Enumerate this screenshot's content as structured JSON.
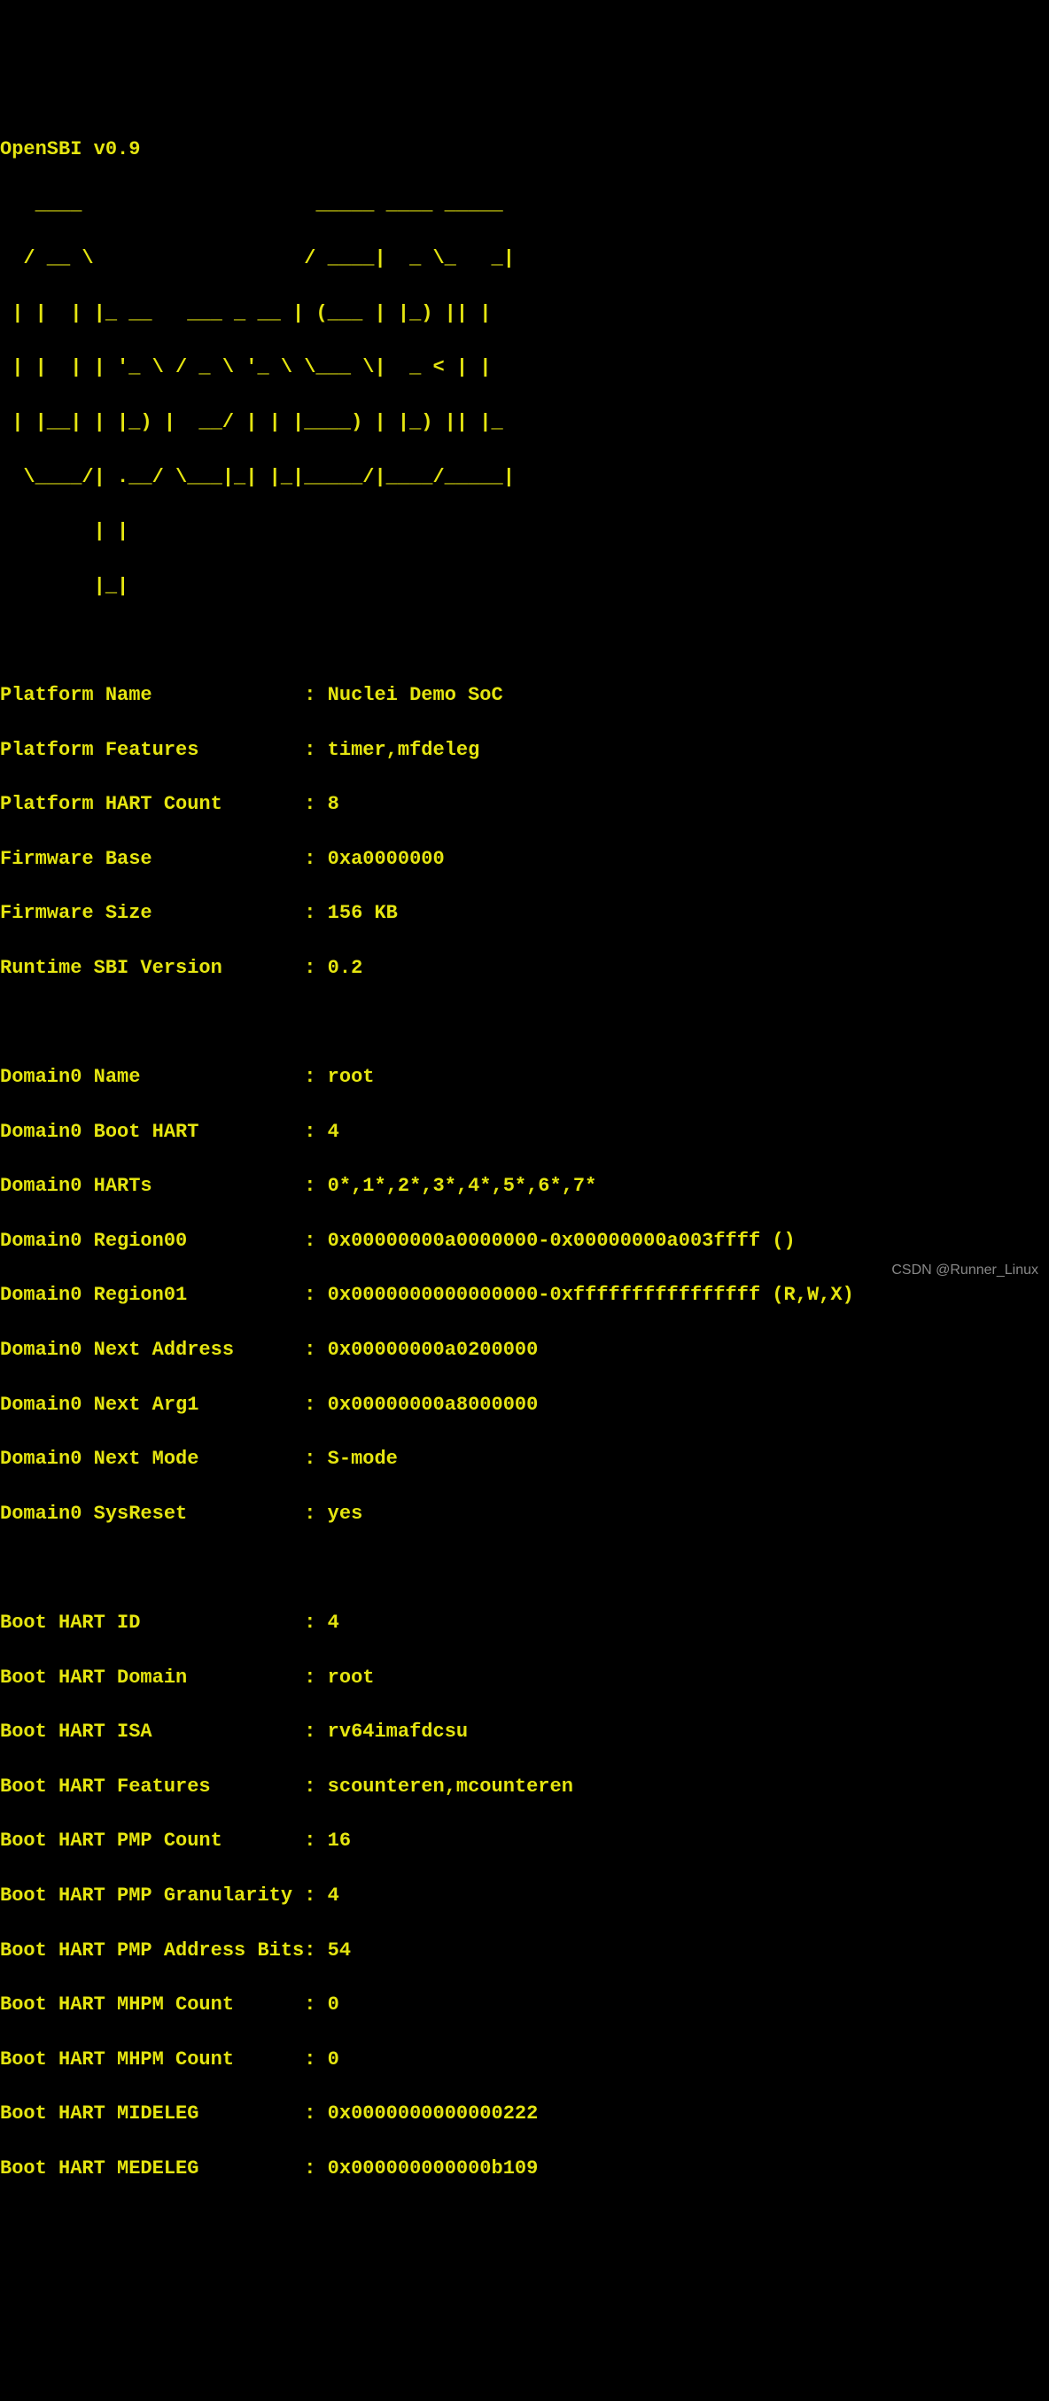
{
  "header": {
    "version": "OpenSBI v0.9"
  },
  "ascii_art": [
    "   ____                    _____ ____ _____",
    "  / __ \\                  / ____|  _ \\_   _|",
    " | |  | |_ __   ___ _ __ | (___ | |_) || |",
    " | |  | | '_ \\ / _ \\ '_ \\ \\___ \\|  _ < | |",
    " | |__| | |_) |  __/ | | |____) | |_) || |_",
    "  \\____/| .__/ \\___|_| |_|_____/|____/_____|",
    "        | |",
    "        |_|"
  ],
  "platform": {
    "name_label": "Platform Name             ",
    "name_value": "Nuclei Demo SoC",
    "features_label": "Platform Features         ",
    "features_value": "timer,mfdeleg",
    "hart_count_label": "Platform HART Count       ",
    "hart_count_value": "8",
    "fw_base_label": "Firmware Base             ",
    "fw_base_value": "0xa0000000",
    "fw_size_label": "Firmware Size             ",
    "fw_size_value": "156 KB",
    "runtime_label": "Runtime SBI Version       ",
    "runtime_value": "0.2"
  },
  "domain": {
    "name_label": "Domain0 Name              ",
    "name_value": "root",
    "boot_hart_label": "Domain0 Boot HART         ",
    "boot_hart_value": "4",
    "harts_label": "Domain0 HARTs             ",
    "harts_value": "0*,1*,2*,3*,4*,5*,6*,7*",
    "region00_label": "Domain0 Region00          ",
    "region00_value": "0x00000000a0000000-0x00000000a003ffff ()",
    "region01_label": "Domain0 Region01          ",
    "region01_value": "0x0000000000000000-0xffffffffffffffff (R,W,X)",
    "next_addr_label": "Domain0 Next Address      ",
    "next_addr_value": "0x00000000a0200000",
    "next_arg1_label": "Domain0 Next Arg1         ",
    "next_arg1_value": "0x00000000a8000000",
    "next_mode_label": "Domain0 Next Mode         ",
    "next_mode_value": "S-mode",
    "sysreset_label": "Domain0 SysReset          ",
    "sysreset_value": "yes"
  },
  "boot": {
    "hart_id_label": "Boot HART ID              ",
    "hart_id_value": "4",
    "hart_domain_label": "Boot HART Domain          ",
    "hart_domain_value": "root",
    "hart_isa_label": "Boot HART ISA             ",
    "hart_isa_value": "rv64imafdcsu",
    "hart_features_label": "Boot HART Features        ",
    "hart_features_value": "scounteren,mcounteren",
    "pmp_count_label": "Boot HART PMP Count       ",
    "pmp_count_value": "16",
    "pmp_gran_label": "Boot HART PMP Granularity ",
    "pmp_gran_value": "4",
    "pmp_addr_bits_label": "Boot HART PMP Address Bits",
    "pmp_addr_bits_value": "54",
    "mhpm_count1_label": "Boot HART MHPM Count      ",
    "mhpm_count1_value": "0",
    "mhpm_count2_label": "Boot HART MHPM Count      ",
    "mhpm_count2_value": "0",
    "mideleg_label": "Boot HART MIDELEG         ",
    "mideleg_value": "0x0000000000000222",
    "medeleg_label": "Boot HART MEDELEG         ",
    "medeleg_value": "0x000000000000b109"
  },
  "separator": ": ",
  "watermark": "CSDN @Runner_Linux"
}
